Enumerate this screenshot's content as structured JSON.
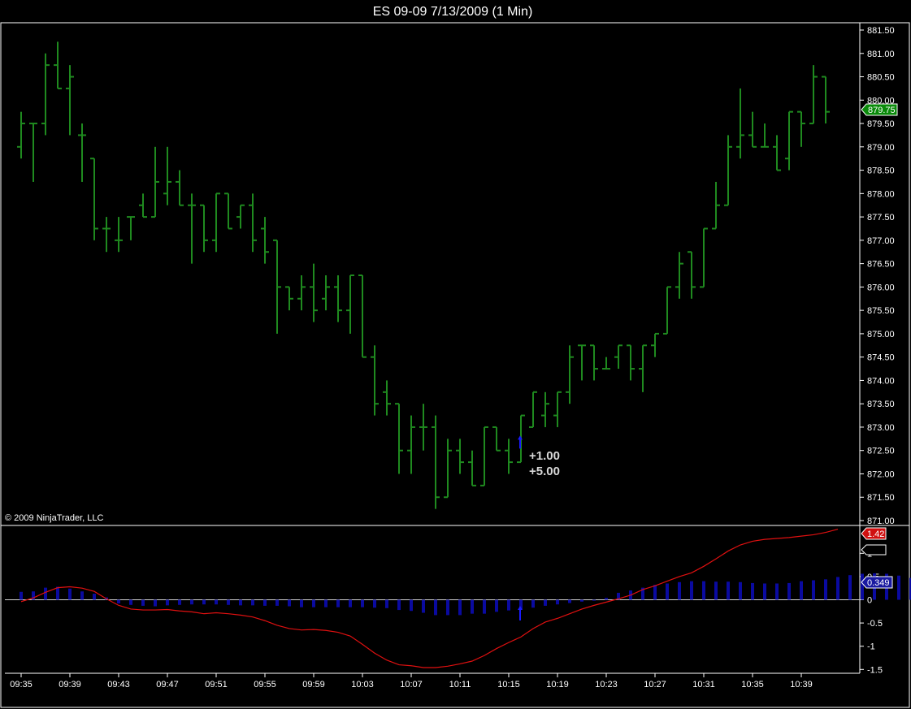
{
  "window": {
    "title": "ES 09-09  7/13/2009 (1 Min)"
  },
  "copyright": "© 2009 NinjaTrader, LLC",
  "colors": {
    "background": "#000000",
    "bars": "#1f8a1f",
    "histogram": "#0a0aa0",
    "signal_line": "#e01010",
    "last_price_tag": "#0a8a0a",
    "macd_tag": "#d01010",
    "hist_tag": "#1a1aa0",
    "entry_arrow": "#1a1aff"
  },
  "annotations": {
    "entry_arrow_icon": "up-arrow-icon",
    "pnl_line1": "+1.00",
    "pnl_line2": "+5.00"
  },
  "tags": {
    "last_price": "879.75",
    "macd_value": "1.42",
    "hist_value": "0.349"
  },
  "chart_data": [
    {
      "type": "ohlc",
      "title": "ES 09-09  7/13/2009 (1 Min)",
      "ylim": [
        871.0,
        881.5
      ],
      "y_ticks": [
        "881.50",
        "881.00",
        "880.50",
        "880.00",
        "879.50",
        "879.00",
        "878.50",
        "878.00",
        "877.50",
        "877.00",
        "876.50",
        "876.00",
        "875.50",
        "875.00",
        "874.50",
        "874.00",
        "873.50",
        "873.00",
        "872.50",
        "872.00",
        "871.50",
        "871.00"
      ],
      "x_ticks": [
        "09:35",
        "09:39",
        "09:43",
        "09:47",
        "09:51",
        "09:55",
        "09:59",
        "10:03",
        "10:07",
        "10:11",
        "10:15",
        "10:19",
        "10:23",
        "10:27",
        "10:31",
        "10:35",
        "10:39"
      ],
      "bars": [
        {
          "t": "09:35",
          "o": 879.0,
          "h": 879.75,
          "l": 878.75,
          "c": 879.5
        },
        {
          "t": "09:36",
          "o": 879.5,
          "h": 879.5,
          "l": 878.25,
          "c": 879.5
        },
        {
          "t": "09:37",
          "o": 879.5,
          "h": 881.0,
          "l": 879.25,
          "c": 880.75
        },
        {
          "t": "09:38",
          "o": 880.75,
          "h": 881.25,
          "l": 880.25,
          "c": 880.25
        },
        {
          "t": "09:39",
          "o": 880.25,
          "h": 880.75,
          "l": 879.25,
          "c": 880.5
        },
        {
          "t": "09:40",
          "o": 879.25,
          "h": 879.5,
          "l": 878.25,
          "c": 879.25
        },
        {
          "t": "09:41",
          "o": 878.75,
          "h": 878.75,
          "l": 877.0,
          "c": 877.25
        },
        {
          "t": "09:42",
          "o": 877.25,
          "h": 877.5,
          "l": 876.75,
          "c": 877.25
        },
        {
          "t": "09:43",
          "o": 877.0,
          "h": 877.5,
          "l": 876.75,
          "c": 877.0
        },
        {
          "t": "09:44",
          "o": 877.5,
          "h": 877.5,
          "l": 877.0,
          "c": 877.5
        },
        {
          "t": "09:45",
          "o": 877.75,
          "h": 878.0,
          "l": 877.5,
          "c": 877.5
        },
        {
          "t": "09:46",
          "o": 877.5,
          "h": 879.0,
          "l": 877.5,
          "c": 878.25
        },
        {
          "t": "09:47",
          "o": 878.0,
          "h": 879.0,
          "l": 877.75,
          "c": 878.25
        },
        {
          "t": "09:48",
          "o": 878.25,
          "h": 878.5,
          "l": 877.75,
          "c": 877.75
        },
        {
          "t": "09:49",
          "o": 877.75,
          "h": 878.0,
          "l": 876.5,
          "c": 877.75
        },
        {
          "t": "09:50",
          "o": 877.75,
          "h": 877.75,
          "l": 876.75,
          "c": 877.0
        },
        {
          "t": "09:51",
          "o": 877.0,
          "h": 878.0,
          "l": 876.75,
          "c": 878.0
        },
        {
          "t": "09:52",
          "o": 878.0,
          "h": 878.0,
          "l": 877.25,
          "c": 877.25
        },
        {
          "t": "09:53",
          "o": 877.5,
          "h": 877.75,
          "l": 877.25,
          "c": 877.75
        },
        {
          "t": "09:54",
          "o": 877.75,
          "h": 878.0,
          "l": 876.75,
          "c": 877.0
        },
        {
          "t": "09:55",
          "o": 877.25,
          "h": 877.5,
          "l": 876.5,
          "c": 876.75
        },
        {
          "t": "09:56",
          "o": 877.0,
          "h": 877.0,
          "l": 875.0,
          "c": 876.0
        },
        {
          "t": "09:57",
          "o": 876.0,
          "h": 876.0,
          "l": 875.5,
          "c": 875.75
        },
        {
          "t": "09:58",
          "o": 875.75,
          "h": 876.25,
          "l": 875.5,
          "c": 876.0
        },
        {
          "t": "09:59",
          "o": 876.0,
          "h": 876.5,
          "l": 875.25,
          "c": 875.5
        },
        {
          "t": "10:00",
          "o": 875.75,
          "h": 876.25,
          "l": 875.5,
          "c": 876.0
        },
        {
          "t": "10:01",
          "o": 876.0,
          "h": 876.25,
          "l": 875.25,
          "c": 875.5
        },
        {
          "t": "10:02",
          "o": 875.5,
          "h": 876.25,
          "l": 875.0,
          "c": 876.25
        },
        {
          "t": "10:03",
          "o": 876.25,
          "h": 876.25,
          "l": 874.5,
          "c": 874.5
        },
        {
          "t": "10:04",
          "o": 874.5,
          "h": 874.75,
          "l": 873.25,
          "c": 873.5
        },
        {
          "t": "10:05",
          "o": 873.75,
          "h": 874.0,
          "l": 873.25,
          "c": 873.5
        },
        {
          "t": "10:06",
          "o": 873.5,
          "h": 873.5,
          "l": 872.0,
          "c": 872.5
        },
        {
          "t": "10:07",
          "o": 872.5,
          "h": 873.25,
          "l": 872.0,
          "c": 873.0
        },
        {
          "t": "10:08",
          "o": 873.0,
          "h": 873.5,
          "l": 872.5,
          "c": 873.0
        },
        {
          "t": "10:09",
          "o": 873.0,
          "h": 873.25,
          "l": 871.25,
          "c": 871.5
        },
        {
          "t": "10:10",
          "o": 871.5,
          "h": 872.75,
          "l": 871.5,
          "c": 872.5
        },
        {
          "t": "10:11",
          "o": 872.5,
          "h": 872.75,
          "l": 872.0,
          "c": 872.25
        },
        {
          "t": "10:12",
          "o": 872.25,
          "h": 872.5,
          "l": 871.75,
          "c": 871.75
        },
        {
          "t": "10:13",
          "o": 871.75,
          "h": 873.0,
          "l": 871.75,
          "c": 873.0
        },
        {
          "t": "10:14",
          "o": 873.0,
          "h": 873.0,
          "l": 872.5,
          "c": 872.5
        },
        {
          "t": "10:15",
          "o": 872.5,
          "h": 872.75,
          "l": 872.0,
          "c": 872.25
        },
        {
          "t": "10:16",
          "o": 872.25,
          "h": 873.25,
          "l": 872.25,
          "c": 873.25
        },
        {
          "t": "10:17",
          "o": 873.0,
          "h": 873.75,
          "l": 873.0,
          "c": 873.75
        },
        {
          "t": "10:18",
          "o": 873.25,
          "h": 873.75,
          "l": 873.0,
          "c": 873.5
        },
        {
          "t": "10:19",
          "o": 873.25,
          "h": 873.75,
          "l": 873.0,
          "c": 873.75
        },
        {
          "t": "10:20",
          "o": 873.75,
          "h": 874.75,
          "l": 873.5,
          "c": 874.5
        },
        {
          "t": "10:21",
          "o": 874.75,
          "h": 874.75,
          "l": 874.0,
          "c": 874.75
        },
        {
          "t": "10:22",
          "o": 874.75,
          "h": 874.75,
          "l": 874.0,
          "c": 874.25
        },
        {
          "t": "10:23",
          "o": 874.25,
          "h": 874.5,
          "l": 874.25,
          "c": 874.25
        },
        {
          "t": "10:24",
          "o": 874.5,
          "h": 874.75,
          "l": 874.25,
          "c": 874.75
        },
        {
          "t": "10:25",
          "o": 874.75,
          "h": 874.75,
          "l": 874.0,
          "c": 874.25
        },
        {
          "t": "10:26",
          "o": 874.25,
          "h": 874.75,
          "l": 873.75,
          "c": 874.75
        },
        {
          "t": "10:27",
          "o": 874.75,
          "h": 875.0,
          "l": 874.5,
          "c": 875.0
        },
        {
          "t": "10:28",
          "o": 875.0,
          "h": 876.0,
          "l": 875.0,
          "c": 876.0
        },
        {
          "t": "10:29",
          "o": 876.0,
          "h": 876.75,
          "l": 875.75,
          "c": 876.5
        },
        {
          "t": "10:30",
          "o": 876.75,
          "h": 876.75,
          "l": 875.75,
          "c": 876.0
        },
        {
          "t": "10:31",
          "o": 876.0,
          "h": 877.25,
          "l": 876.0,
          "c": 877.25
        },
        {
          "t": "10:32",
          "o": 877.25,
          "h": 878.25,
          "l": 877.25,
          "c": 877.75
        },
        {
          "t": "10:33",
          "o": 877.75,
          "h": 879.25,
          "l": 877.75,
          "c": 879.0
        },
        {
          "t": "10:34",
          "o": 879.0,
          "h": 880.25,
          "l": 878.75,
          "c": 879.25
        },
        {
          "t": "10:35",
          "o": 879.25,
          "h": 879.75,
          "l": 879.0,
          "c": 879.0
        },
        {
          "t": "10:36",
          "o": 879.0,
          "h": 879.5,
          "l": 879.0,
          "c": 879.0
        },
        {
          "t": "10:37",
          "o": 879.0,
          "h": 879.25,
          "l": 878.5,
          "c": 878.5
        },
        {
          "t": "10:38",
          "o": 878.75,
          "h": 879.75,
          "l": 878.5,
          "c": 879.75
        },
        {
          "t": "10:39",
          "o": 879.75,
          "h": 879.75,
          "l": 879.0,
          "c": 879.5
        },
        {
          "t": "10:40",
          "o": 879.5,
          "h": 880.75,
          "l": 879.5,
          "c": 880.5
        },
        {
          "t": "10:41",
          "o": 880.5,
          "h": 880.5,
          "l": 879.5,
          "c": 879.75
        }
      ],
      "entry_marker": {
        "t": "10:16",
        "price": 872.75
      }
    },
    {
      "type": "line+histogram",
      "ylim": [
        -1.5,
        1.5
      ],
      "y_ticks": [
        1,
        0.5,
        0,
        -0.5,
        -1,
        -1.5
      ],
      "y_tick_labels": [
        "1",
        "0.5",
        "0",
        "-0.5",
        "-1",
        "-1.5"
      ],
      "histogram": [
        0.17,
        0.18,
        0.26,
        0.28,
        0.24,
        0.18,
        0.13,
        0.05,
        -0.08,
        -0.11,
        -0.13,
        -0.14,
        -0.12,
        -0.11,
        -0.1,
        -0.1,
        -0.1,
        -0.11,
        -0.12,
        -0.12,
        -0.13,
        -0.13,
        -0.14,
        -0.16,
        -0.16,
        -0.16,
        -0.16,
        -0.16,
        -0.16,
        -0.17,
        -0.18,
        -0.22,
        -0.24,
        -0.28,
        -0.33,
        -0.33,
        -0.33,
        -0.3,
        -0.3,
        -0.26,
        -0.23,
        -0.2,
        -0.17,
        -0.13,
        -0.1,
        -0.07,
        -0.04,
        -0.02,
        0.04,
        0.15,
        0.2,
        0.26,
        0.32,
        0.35,
        0.38,
        0.4,
        0.4,
        0.39,
        0.39,
        0.38,
        0.36,
        0.35,
        0.35,
        0.36,
        0.4,
        0.42,
        0.44,
        0.49,
        0.53,
        0.56,
        0.57,
        0.56,
        0.52,
        0.47,
        0.42,
        0.38,
        0.36,
        0.35,
        0.35
      ],
      "signal_line": [
        -0.04,
        0.04,
        0.16,
        0.26,
        0.28,
        0.25,
        0.18,
        0.02,
        -0.12,
        -0.2,
        -0.22,
        -0.22,
        -0.21,
        -0.24,
        -0.26,
        -0.3,
        -0.28,
        -0.3,
        -0.33,
        -0.37,
        -0.45,
        -0.55,
        -0.62,
        -0.65,
        -0.64,
        -0.66,
        -0.7,
        -0.78,
        -0.96,
        -1.15,
        -1.3,
        -1.4,
        -1.42,
        -1.46,
        -1.46,
        -1.43,
        -1.38,
        -1.32,
        -1.2,
        -1.05,
        -0.92,
        -0.8,
        -0.62,
        -0.48,
        -0.4,
        -0.3,
        -0.2,
        -0.12,
        -0.05,
        0.02,
        0.1,
        0.22,
        0.3,
        0.4,
        0.5,
        0.58,
        0.72,
        0.88,
        1.05,
        1.18,
        1.26,
        1.3,
        1.32,
        1.34,
        1.37,
        1.4,
        1.45,
        1.52
      ],
      "last_macd": 1.42,
      "last_hist": 0.349
    }
  ]
}
